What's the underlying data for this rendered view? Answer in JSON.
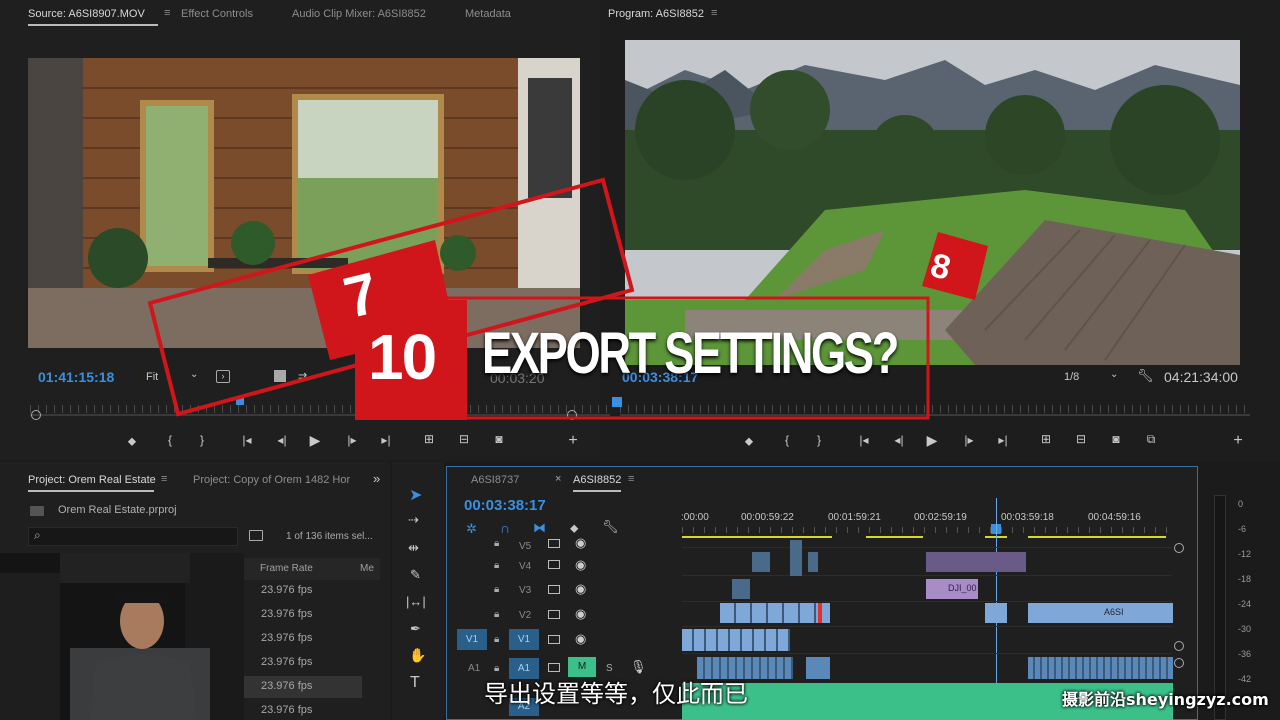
{
  "source_panel": {
    "tabs": [
      {
        "label": "Source: A6SI8907.MOV",
        "active": true
      },
      {
        "label": "Effect Controls",
        "active": false
      },
      {
        "label": "Audio Clip Mixer: A6SI8852",
        "active": false
      },
      {
        "label": "Metadata",
        "active": false
      }
    ],
    "timecode": "01:41:15:18",
    "fit": "Fit",
    "duration": "00:03:20"
  },
  "program_panel": {
    "tab": "Program: A6SI8852",
    "timecode": "00:03:38:17",
    "resolution": "1/8",
    "duration": "04:21:34:00"
  },
  "overlay": {
    "badge_7": "7",
    "badge_8": "8",
    "badge_10": "10",
    "headline": "EXPORT SETTINGS?"
  },
  "project_panel": {
    "tabs": [
      {
        "label": "Project: Orem Real Estate",
        "active": true
      },
      {
        "label": "Project: Copy of Orem 1482 Hor",
        "active": false
      }
    ],
    "more": "»",
    "file": "Orem Real Estate.prproj",
    "item_count": "1 of 136 items sel...",
    "columns": [
      "Frame Rate",
      "Me"
    ],
    "rows": [
      "23.976 fps",
      "23.976 fps",
      "23.976 fps",
      "23.976 fps",
      "23.976 fps",
      "23.976 fps"
    ]
  },
  "timeline": {
    "tabs": [
      {
        "label": "A6SI8737",
        "active": false
      },
      {
        "label": "A6SI8852",
        "active": true
      }
    ],
    "timecode": "00:03:38:17",
    "ruler": [
      ":00:00",
      "00:00:59:22",
      "00:01:59:21",
      "00:02:59:19",
      "00:03:59:18",
      "00:04:59:16"
    ],
    "tracks": [
      {
        "name": "V5",
        "patch": ""
      },
      {
        "name": "V4",
        "patch": ""
      },
      {
        "name": "V3",
        "patch": ""
      },
      {
        "name": "V2",
        "patch": ""
      },
      {
        "name": "V1",
        "patch": "V1"
      },
      {
        "name": "A1",
        "patch": "A1"
      },
      {
        "name": "A2",
        "patch": ""
      }
    ],
    "clip_labels": [
      "DJI_00",
      "A6SI"
    ],
    "audio_buttons": {
      "m": "M",
      "s": "S"
    }
  },
  "meter_scale": [
    "0",
    "-6",
    "-12",
    "-18",
    "-24",
    "-30",
    "-36",
    "-42"
  ],
  "subtitle": "导出设置等等，仅此而已",
  "watermark": "摄影前沿sheyingzyz.com",
  "colors": {
    "accent_blue": "#3a8fe0",
    "overlay_red": "#d0161a",
    "clip_blue": "#7fa8d8",
    "clip_purple": "#a88cc8",
    "audio_green": "#3cc08a"
  }
}
